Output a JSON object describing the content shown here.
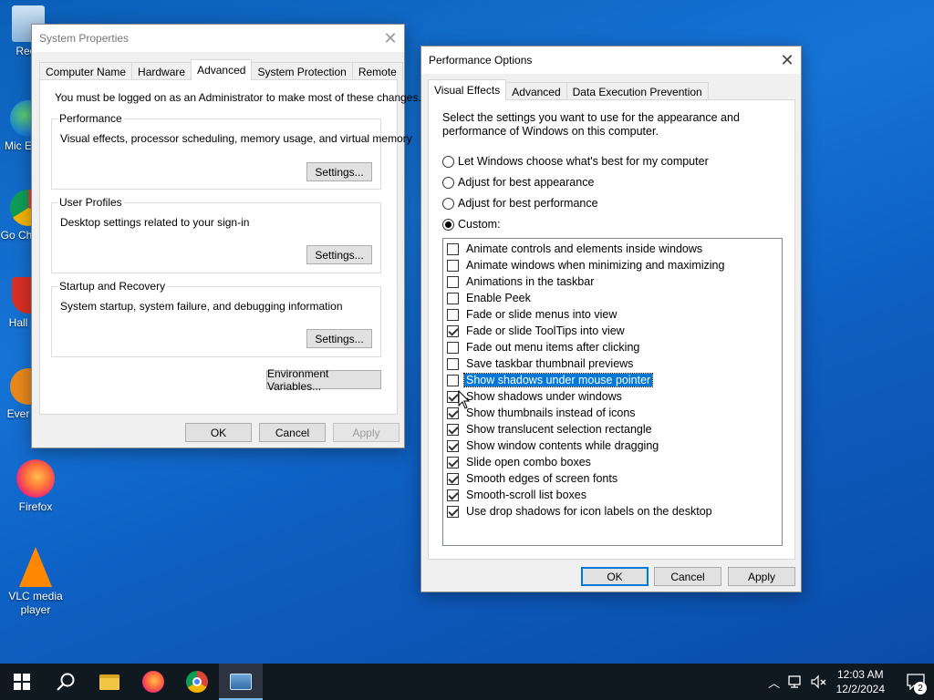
{
  "desktop": {
    "icons": [
      {
        "label": "Recy"
      },
      {
        "label": "Mic E"
      },
      {
        "label": "Go Chr"
      },
      {
        "label": "Hall"
      },
      {
        "label": "Ever"
      },
      {
        "label": "Firefox"
      },
      {
        "label": "VLC media player"
      }
    ]
  },
  "system_properties": {
    "title": "System Properties",
    "tabs": [
      "Computer Name",
      "Hardware",
      "Advanced",
      "System Protection",
      "Remote"
    ],
    "active_tab": "Advanced",
    "admin_notice": "You must be logged on as an Administrator to make most of these changes.",
    "groups": [
      {
        "title": "Performance",
        "desc": "Visual effects, processor scheduling, memory usage, and virtual memory",
        "button": "Settings..."
      },
      {
        "title": "User Profiles",
        "desc": "Desktop settings related to your sign-in",
        "button": "Settings..."
      },
      {
        "title": "Startup and Recovery",
        "desc": "System startup, system failure, and debugging information",
        "button": "Settings..."
      }
    ],
    "env_button": "Environment Variables...",
    "ok": "OK",
    "cancel": "Cancel",
    "apply": "Apply"
  },
  "performance_options": {
    "title": "Performance Options",
    "tabs": [
      "Visual Effects",
      "Advanced",
      "Data Execution Prevention"
    ],
    "active_tab": "Visual Effects",
    "intro": "Select the settings you want to use for the appearance and performance of Windows on this computer.",
    "radios": [
      {
        "label": "Let Windows choose what's best for my computer",
        "selected": false
      },
      {
        "label": "Adjust for best appearance",
        "selected": false
      },
      {
        "label": "Adjust for best performance",
        "selected": false
      },
      {
        "label": "Custom:",
        "selected": true
      }
    ],
    "effects": [
      {
        "label": "Animate controls and elements inside windows",
        "checked": false
      },
      {
        "label": "Animate windows when minimizing and maximizing",
        "checked": false
      },
      {
        "label": "Animations in the taskbar",
        "checked": false
      },
      {
        "label": "Enable Peek",
        "checked": false
      },
      {
        "label": "Fade or slide menus into view",
        "checked": false
      },
      {
        "label": "Fade or slide ToolTips into view",
        "checked": true
      },
      {
        "label": "Fade out menu items after clicking",
        "checked": false
      },
      {
        "label": "Save taskbar thumbnail previews",
        "checked": false
      },
      {
        "label": "Show shadows under mouse pointer",
        "checked": false,
        "selected": true
      },
      {
        "label": "Show shadows under windows",
        "checked": true
      },
      {
        "label": "Show thumbnails instead of icons",
        "checked": true
      },
      {
        "label": "Show translucent selection rectangle",
        "checked": true
      },
      {
        "label": "Show window contents while dragging",
        "checked": true
      },
      {
        "label": "Slide open combo boxes",
        "checked": true
      },
      {
        "label": "Smooth edges of screen fonts",
        "checked": true
      },
      {
        "label": "Smooth-scroll list boxes",
        "checked": true
      },
      {
        "label": "Use drop shadows for icon labels on the desktop",
        "checked": true
      }
    ],
    "ok": "OK",
    "cancel": "Cancel",
    "apply": "Apply"
  },
  "taskbar": {
    "time": "12:03 AM",
    "date": "12/2/2024",
    "notification_count": "2"
  }
}
